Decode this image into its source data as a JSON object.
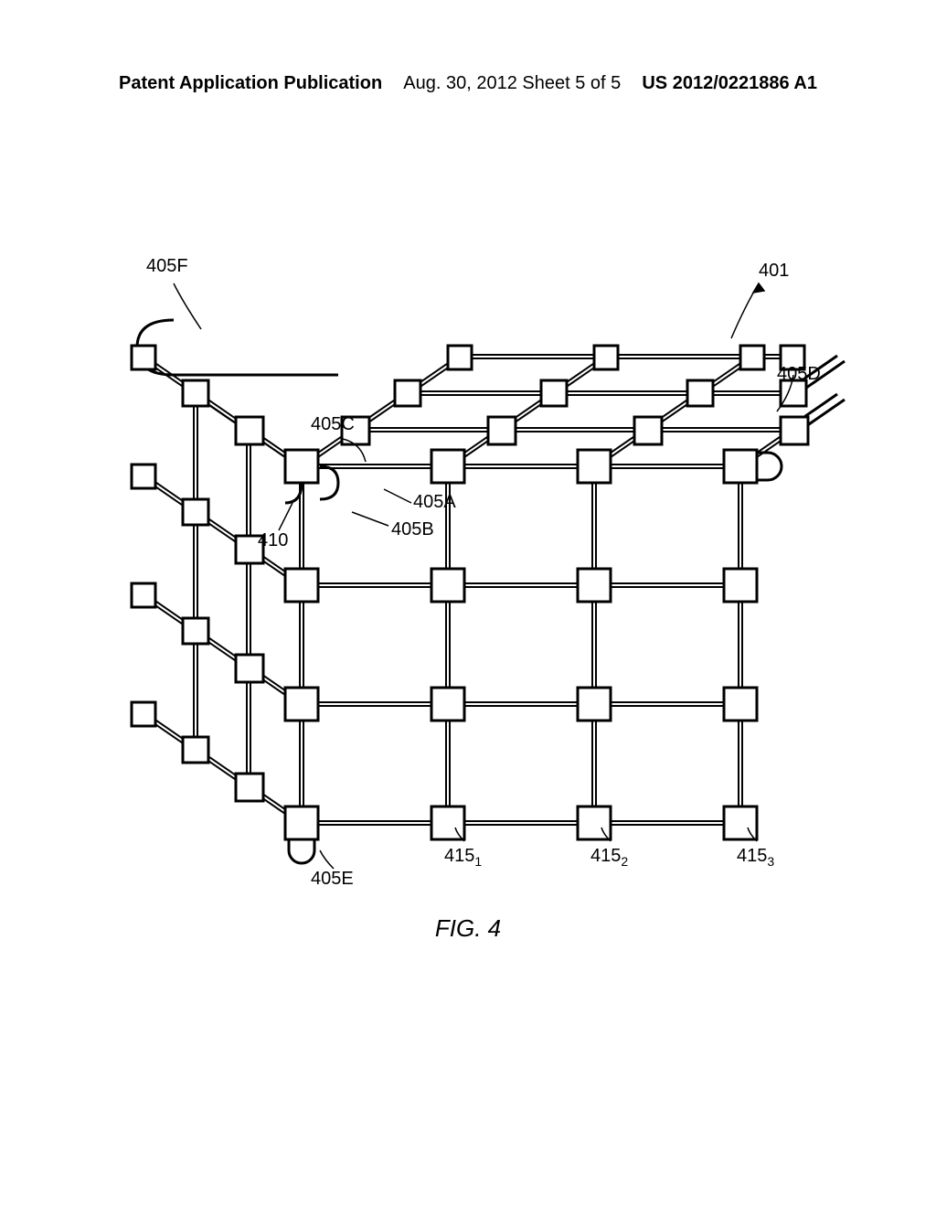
{
  "header": {
    "left": "Patent Application Publication",
    "center": "Aug. 30, 2012  Sheet 5 of 5",
    "right": "US 2012/0221886 A1"
  },
  "figure": {
    "caption": "FIG. 4",
    "labels": {
      "l401": "401",
      "l405A": "405A",
      "l405B": "405B",
      "l405C": "405C",
      "l405D": "405D",
      "l405E": "405E",
      "l405F": "405F",
      "l410": "410",
      "l415_1": "415",
      "l415_1_sub": "1",
      "l415_2": "415",
      "l415_2_sub": "2",
      "l415_3": "415",
      "l415_3_sub": "3"
    }
  }
}
